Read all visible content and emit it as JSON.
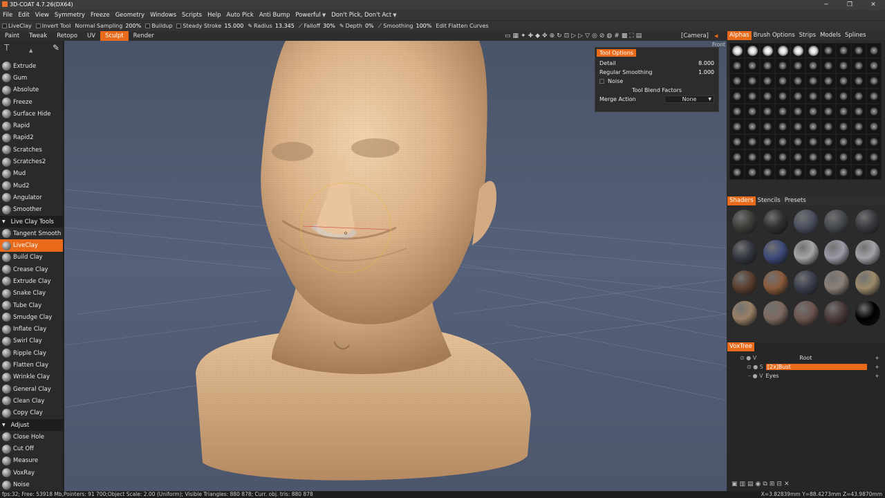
{
  "title": "3D-COAT 4.7.26(DX64)",
  "window_controls": [
    "─",
    "❐",
    "✕"
  ],
  "menu": [
    "File",
    "Edit",
    "View",
    "Symmetry",
    "Freeze",
    "Geometry",
    "Windows",
    "Scripts",
    "Help",
    "Auto Pick",
    "Anti Bump",
    "Powerful",
    "Don't Pick, Don't Act"
  ],
  "toolbar": {
    "tool": "LiveClay",
    "invert_tool": "Invert Tool",
    "sampling_label": "Normal Sampling",
    "sampling_value": "200%",
    "buildup": "Buildup",
    "steady_label": "Steady Stroke",
    "steady_value": "15.000",
    "radius_label": "Radius",
    "radius_value": "13.345",
    "falloff_label": "Falloff",
    "falloff_value": "30%",
    "depth_label": "Depth",
    "depth_value": "0%",
    "smoothing_label": "Smoothing",
    "smoothing_value": "100%",
    "edit_curves": "Edit Flatten Curves"
  },
  "rooms": [
    "Paint",
    "Tweak",
    "Retopo",
    "UV",
    "Sculpt",
    "Render"
  ],
  "active_room": "Sculpt",
  "camera": "[Camera]",
  "view_label": "Front",
  "left_tools": [
    {
      "label": "Extrude",
      "type": "tool"
    },
    {
      "label": "Gum",
      "type": "tool"
    },
    {
      "label": "Absolute",
      "type": "tool"
    },
    {
      "label": "Freeze",
      "type": "tool"
    },
    {
      "label": "Surface Hide",
      "type": "tool"
    },
    {
      "label": "Rapid",
      "type": "tool"
    },
    {
      "label": "Rapid2",
      "type": "tool"
    },
    {
      "label": "Scratches",
      "type": "tool"
    },
    {
      "label": "Scratches2",
      "type": "tool"
    },
    {
      "label": "Mud",
      "type": "tool"
    },
    {
      "label": "Mud2",
      "type": "tool"
    },
    {
      "label": "Angulator",
      "type": "tool"
    },
    {
      "label": "Smoother",
      "type": "tool"
    },
    {
      "label": "Live Clay  Tools",
      "type": "section"
    },
    {
      "label": "Tangent Smooth",
      "type": "tool"
    },
    {
      "label": "LiveClay",
      "type": "active"
    },
    {
      "label": "Build Clay",
      "type": "tool"
    },
    {
      "label": "Crease Clay",
      "type": "tool"
    },
    {
      "label": "Extrude Clay",
      "type": "tool"
    },
    {
      "label": "Snake Clay",
      "type": "tool"
    },
    {
      "label": "Tube Clay",
      "type": "tool"
    },
    {
      "label": "Smudge Clay",
      "type": "tool"
    },
    {
      "label": "Inflate Clay",
      "type": "tool"
    },
    {
      "label": "Swirl Clay",
      "type": "tool"
    },
    {
      "label": "Ripple Clay",
      "type": "tool"
    },
    {
      "label": "Flatten Clay",
      "type": "tool"
    },
    {
      "label": "Wrinkle Clay",
      "type": "tool"
    },
    {
      "label": "General Clay",
      "type": "tool"
    },
    {
      "label": "Clean Clay",
      "type": "tool"
    },
    {
      "label": "Copy Clay",
      "type": "tool"
    },
    {
      "label": "Adjust",
      "type": "section"
    },
    {
      "label": "Close Hole",
      "type": "tool"
    },
    {
      "label": "Cut Off",
      "type": "tool"
    },
    {
      "label": "Measure",
      "type": "tool"
    },
    {
      "label": "VoxRay",
      "type": "tool"
    },
    {
      "label": "Noise",
      "type": "tool"
    }
  ],
  "tool_options": {
    "header": "Tool Options",
    "detail_label": "Detail",
    "detail_value": "8.000",
    "regular_smoothing_label": "Regular Smoothing",
    "regular_smoothing_value": "1.000",
    "noise_label": "Noise",
    "blend_factors": "Tool Blend Factors",
    "merge_label": "Merge Action",
    "merge_value": "None"
  },
  "right_tabs": [
    "Alphas",
    "Brush Options",
    "Strips",
    "Models",
    "Splines"
  ],
  "shader_tabs": [
    "Shaders",
    "Stencils",
    "Presets"
  ],
  "shader_colors": [
    "#3d3d3a",
    "#2e2f31",
    "#4a5060",
    "#45484f",
    "#383a40",
    "#33373f",
    "#3e4a7a",
    "#a7a5a3",
    "#9b9aa6",
    "#a3a2a8",
    "#5a3e2e",
    "#8a5a3a",
    "#3a3f4e",
    "#8c8078",
    "#9c8a6a",
    "#9a8066",
    "#7e6a60",
    "#6d5650",
    "#4a3a38",
    "#000000"
  ],
  "voxtree": {
    "tab": "VoxTree",
    "root": "Root",
    "items": [
      "[2x]Bust",
      "Eyes"
    ]
  },
  "status": {
    "left": "fps:32;     Free: 53918 Mb,Pointers: 91 700;Object Scale: 2.00 (Uniform);  Visible  Triangles: 880 878;  Curr. obj. tris: 880 878",
    "right": "X=3.82839mm  Y=88.4273mm  Z=43.9870mm"
  }
}
